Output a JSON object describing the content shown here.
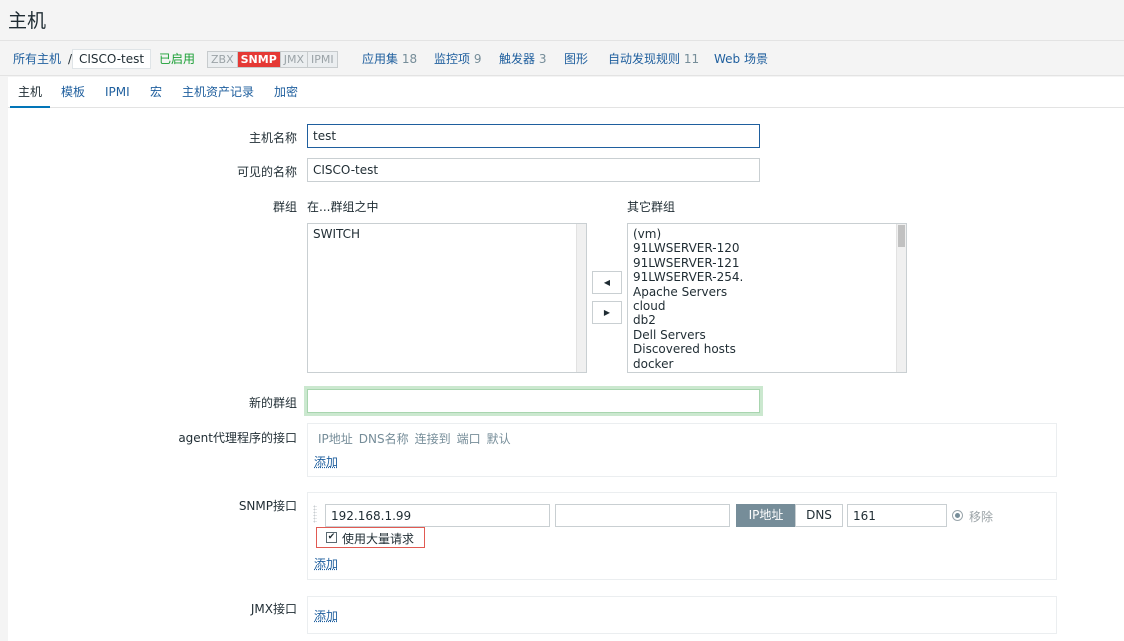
{
  "page_title": "主机",
  "breadcrumb": {
    "all_hosts": "所有主机",
    "separator": "/",
    "current": "CISCO-test"
  },
  "status": "已启用",
  "availability": [
    "ZBX",
    "SNMP",
    "JMX",
    "IPMI"
  ],
  "availability_active": "SNMP",
  "nav": {
    "applications": {
      "label": "应用集",
      "count": "18"
    },
    "items": {
      "label": "监控项",
      "count": "9"
    },
    "triggers": {
      "label": "触发器",
      "count": "3"
    },
    "graphs": {
      "label": "图形"
    },
    "discovery": {
      "label": "自动发现规则",
      "count": "11"
    },
    "web": {
      "label": "Web 场景"
    }
  },
  "tabs": [
    "主机",
    "模板",
    "IPMI",
    "宏",
    "主机资产记录",
    "加密"
  ],
  "form": {
    "host_name_label": "主机名称",
    "host_name_value": "test",
    "visible_name_label": "可见的名称",
    "visible_name_value": "CISCO-test",
    "groups_label": "群组",
    "in_groups_label": "在...群组之中",
    "other_groups_label": "其它群组",
    "in_groups": [
      "SWITCH"
    ],
    "other_groups": [
      "(vm)",
      "91LWSERVER-120",
      "91LWSERVER-121",
      "91LWSERVER-254.",
      "Apache Servers",
      "cloud",
      "db2",
      "Dell Servers",
      "Discovered hosts",
      "docker"
    ],
    "move_left_glyph": "◀",
    "move_right_glyph": "▶",
    "new_group_label": "新的群组",
    "new_group_value": "",
    "agent_label": "agent代理程序的接口",
    "agent_columns": [
      "IP地址",
      "DNS名称",
      "连接到",
      "端口",
      "默认"
    ],
    "add_label": "添加",
    "snmp_label": "SNMP接口",
    "snmp_ip": "192.168.1.99",
    "snmp_dns": "",
    "connect_ip": "IP地址",
    "connect_dns": "DNS",
    "snmp_port": "161",
    "remove_label": "移除",
    "bulk_label": "使用大量请求",
    "bulk_checked": "✔",
    "jmx_label": "JMX接口"
  },
  "colors": {
    "link": "#1f5f9e",
    "enabled": "#1a9f35",
    "snmp_active": "#e53935",
    "highlight_border": "#e15a52"
  }
}
